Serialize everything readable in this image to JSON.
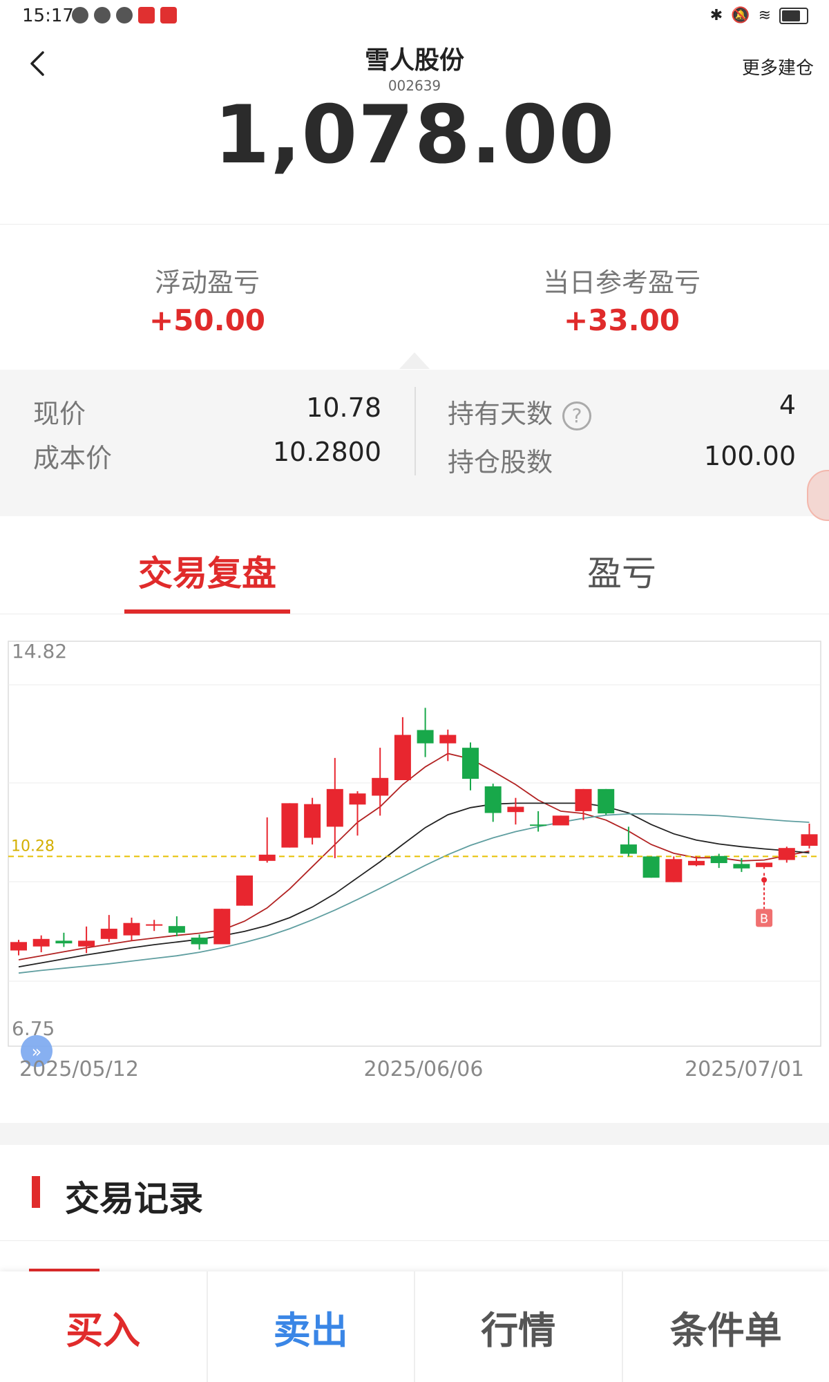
{
  "status_bar": {
    "time": "15:17"
  },
  "header": {
    "stock_name": "雪人股份",
    "stock_code": "002639",
    "more_label": "更多建仓",
    "market_value": "1,078.00"
  },
  "pnl": {
    "floating_label": "浮动盈亏",
    "floating_value": "+50.00",
    "daily_label": "当日参考盈亏",
    "daily_value": "+33.00"
  },
  "info": {
    "price_label": "现价",
    "price_value": "10.78",
    "cost_label": "成本价",
    "cost_value": "10.2800",
    "days_label": "持有天数",
    "days_help_icon": "?",
    "days_value": "4",
    "shares_label": "持仓股数",
    "shares_value": "100.00"
  },
  "tabs": [
    {
      "label": "交易复盘",
      "active": true
    },
    {
      "label": "盈亏",
      "active": false
    }
  ],
  "chart_data": {
    "type": "candlestick",
    "y_max_label": "14.82",
    "y_min_label": "6.75",
    "ylim": [
      6.75,
      14.82
    ],
    "cost_line": {
      "value": 10.28,
      "label": "10.28",
      "color": "#e6c000"
    },
    "x_tick_labels": [
      "2025/05/12",
      "2025/06/06",
      "2025/07/01"
    ],
    "buy_marker": {
      "label": "B",
      "index": 33
    },
    "up_color": "#e8262f",
    "down_color": "#18a84a",
    "candles": [
      {
        "o": 8.16,
        "c": 8.35,
        "h": 8.4,
        "l": 8.05
      },
      {
        "o": 8.25,
        "c": 8.42,
        "h": 8.5,
        "l": 8.12
      },
      {
        "o": 8.38,
        "c": 8.32,
        "h": 8.56,
        "l": 8.24
      },
      {
        "o": 8.25,
        "c": 8.38,
        "h": 8.7,
        "l": 8.1
      },
      {
        "o": 8.42,
        "c": 8.65,
        "h": 8.96,
        "l": 8.35
      },
      {
        "o": 8.5,
        "c": 8.78,
        "h": 8.9,
        "l": 8.38
      },
      {
        "o": 8.72,
        "c": 8.75,
        "h": 8.85,
        "l": 8.6
      },
      {
        "o": 8.71,
        "c": 8.56,
        "h": 8.93,
        "l": 8.48
      },
      {
        "o": 8.45,
        "c": 8.3,
        "h": 8.52,
        "l": 8.18
      },
      {
        "o": 8.3,
        "c": 9.1,
        "h": 9.1,
        "l": 8.3
      },
      {
        "o": 9.17,
        "c": 9.85,
        "h": 9.85,
        "l": 9.17
      },
      {
        "o": 10.18,
        "c": 10.32,
        "h": 11.16,
        "l": 10.14
      },
      {
        "o": 10.48,
        "c": 11.48,
        "h": 11.48,
        "l": 10.48
      },
      {
        "o": 10.7,
        "c": 11.46,
        "h": 11.6,
        "l": 10.55
      },
      {
        "o": 10.95,
        "c": 11.8,
        "h": 12.5,
        "l": 10.24
      },
      {
        "o": 11.45,
        "c": 11.7,
        "h": 11.75,
        "l": 10.75
      },
      {
        "o": 11.65,
        "c": 12.05,
        "h": 12.73,
        "l": 11.2
      },
      {
        "o": 12.0,
        "c": 13.02,
        "h": 13.42,
        "l": 12.0
      },
      {
        "o": 13.13,
        "c": 12.83,
        "h": 13.63,
        "l": 12.52
      },
      {
        "o": 12.83,
        "c": 13.02,
        "h": 13.14,
        "l": 12.43
      },
      {
        "o": 12.73,
        "c": 12.03,
        "h": 12.85,
        "l": 11.77
      },
      {
        "o": 11.86,
        "c": 11.26,
        "h": 11.92,
        "l": 11.06
      },
      {
        "o": 11.28,
        "c": 11.4,
        "h": 11.6,
        "l": 11.0
      },
      {
        "o": 11.0,
        "c": 10.98,
        "h": 11.3,
        "l": 10.84
      },
      {
        "o": 10.98,
        "c": 11.2,
        "h": 11.2,
        "l": 10.98
      },
      {
        "o": 11.3,
        "c": 11.8,
        "h": 11.8,
        "l": 11.1
      },
      {
        "o": 11.8,
        "c": 11.25,
        "h": 11.8,
        "l": 11.22
      },
      {
        "o": 10.55,
        "c": 10.34,
        "h": 10.95,
        "l": 10.28
      },
      {
        "o": 10.28,
        "c": 9.8,
        "h": 10.28,
        "l": 9.8
      },
      {
        "o": 9.7,
        "c": 10.22,
        "h": 10.28,
        "l": 9.7
      },
      {
        "o": 10.08,
        "c": 10.18,
        "h": 10.28,
        "l": 10.06
      },
      {
        "o": 10.29,
        "c": 10.13,
        "h": 10.34,
        "l": 10.02
      },
      {
        "o": 10.11,
        "c": 10.01,
        "h": 10.24,
        "l": 9.93
      },
      {
        "o": 10.04,
        "c": 10.14,
        "h": 10.14,
        "l": 10.0
      },
      {
        "o": 10.2,
        "c": 10.47,
        "h": 10.5,
        "l": 10.14
      },
      {
        "o": 10.52,
        "c": 10.78,
        "h": 11.02,
        "l": 10.46
      }
    ],
    "ma_series": [
      {
        "color": "#b22222",
        "values": [
          7.95,
          8.04,
          8.13,
          8.22,
          8.3,
          8.38,
          8.44,
          8.5,
          8.55,
          8.62,
          8.82,
          9.12,
          9.55,
          10.05,
          10.55,
          11.05,
          11.4,
          11.9,
          12.3,
          12.6,
          12.48,
          12.2,
          11.9,
          11.55,
          11.3,
          11.25,
          11.1,
          10.85,
          10.55,
          10.35,
          10.25,
          10.25,
          10.18,
          10.2,
          10.3,
          10.4
        ]
      },
      {
        "color": "#222222",
        "values": [
          7.79,
          7.88,
          7.97,
          8.06,
          8.14,
          8.22,
          8.29,
          8.35,
          8.41,
          8.49,
          8.59,
          8.72,
          8.9,
          9.14,
          9.44,
          9.8,
          10.16,
          10.55,
          10.93,
          11.22,
          11.38,
          11.46,
          11.48,
          11.48,
          11.48,
          11.48,
          11.4,
          11.26,
          11.0,
          10.79,
          10.65,
          10.56,
          10.5,
          10.45,
          10.41,
          10.36
        ]
      },
      {
        "color": "#5f9ea0",
        "values": [
          7.65,
          7.71,
          7.76,
          7.81,
          7.86,
          7.92,
          7.98,
          8.04,
          8.12,
          8.22,
          8.34,
          8.48,
          8.65,
          8.85,
          9.07,
          9.31,
          9.56,
          9.82,
          10.08,
          10.32,
          10.53,
          10.7,
          10.84,
          10.95,
          11.05,
          11.14,
          11.21,
          11.24,
          11.24,
          11.23,
          11.22,
          11.2,
          11.16,
          11.12,
          11.08,
          11.05
        ]
      }
    ]
  },
  "records": {
    "title": "交易记录"
  },
  "bottom_bar": {
    "buy": "买入",
    "sell": "卖出",
    "quote": "行情",
    "conditional": "条件单"
  },
  "colors": {
    "accent_red": "#e02b2b",
    "sell_blue": "#3a86e6"
  }
}
